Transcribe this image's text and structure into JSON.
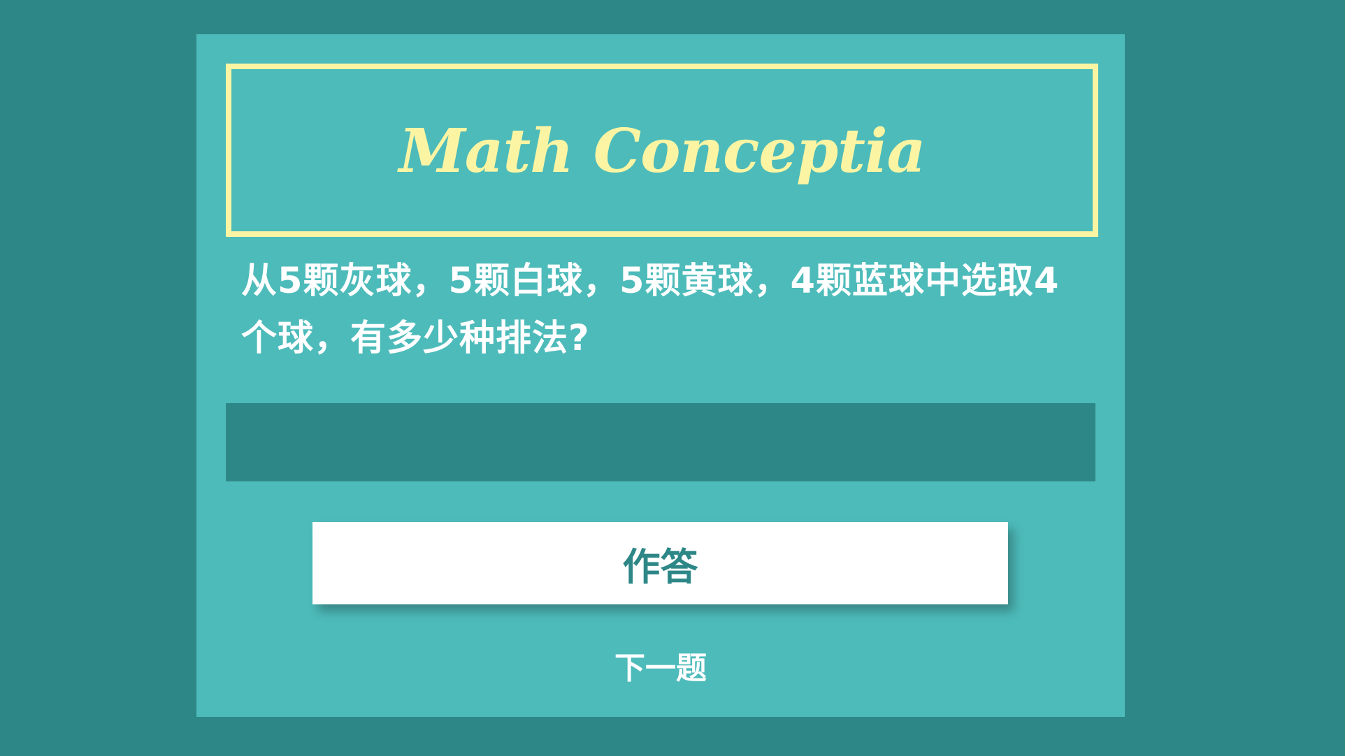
{
  "app": {
    "title": "Math Conceptia"
  },
  "question": {
    "text": "从5颗灰球，5颗白球，5颗黄球，4颗蓝球中选取4个球，有多少种排法?"
  },
  "answer": {
    "value": "",
    "placeholder": ""
  },
  "actions": {
    "submit_label": "作答",
    "next_label": "下一题"
  },
  "colors": {
    "background": "#2e8787",
    "card": "#4dbbba",
    "accent": "#fbf5a3",
    "button": "#ffffff",
    "button_text": "#2e8787"
  }
}
